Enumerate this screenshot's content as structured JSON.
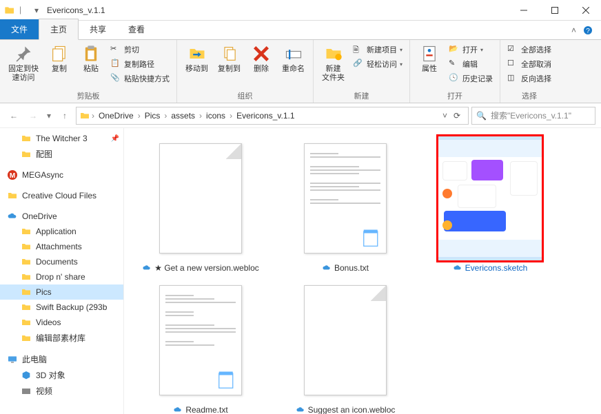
{
  "title": "Evericons_v.1.1",
  "tabs": {
    "file": "文件",
    "home": "主页",
    "share": "共享",
    "view": "查看"
  },
  "ribbon": {
    "pin": "固定到快\n速访问",
    "copy": "复制",
    "paste": "粘贴",
    "cut": "剪切",
    "copypath": "复制路径",
    "pasteshortcut": "粘贴快捷方式",
    "clipboard": "剪贴板",
    "moveto": "移动到",
    "copyto": "复制到",
    "delete": "删除",
    "rename": "重命名",
    "organize": "组织",
    "newfolder": "新建\n文件夹",
    "newitem": "新建项目",
    "easyaccess": "轻松访问",
    "new": "新建",
    "properties": "属性",
    "open": "打开",
    "edit": "编辑",
    "history": "历史记录",
    "opengrp": "打开",
    "selectall": "全部选择",
    "selectnone": "全部取消",
    "invert": "反向选择",
    "select": "选择"
  },
  "breadcrumbs": [
    "OneDrive",
    "Pics",
    "assets",
    "icons",
    "Evericons_v.1.1"
  ],
  "search_placeholder": "搜索\"Evericons_v.1.1\"",
  "tree": {
    "witcher": "The Witcher 3",
    "peitu": "配图",
    "mega": "MEGAsync",
    "ccf": "Creative Cloud Files",
    "onedrive": "OneDrive",
    "application": "Application",
    "attachments": "Attachments",
    "documents": "Documents",
    "dropnshare": "Drop n' share",
    "pics": "Pics",
    "swift": "Swift Backup (293b",
    "videos": "Videos",
    "bianji": "编辑部素材库",
    "thispc": "此电脑",
    "objects3d": "3D 对象",
    "shipin": "视频"
  },
  "files": {
    "f1": "★ Get a new version.webloc",
    "f2": "Bonus.txt",
    "f3": "Evericons.sketch",
    "f4": "Readme.txt",
    "f5": "Suggest an icon.webloc"
  }
}
